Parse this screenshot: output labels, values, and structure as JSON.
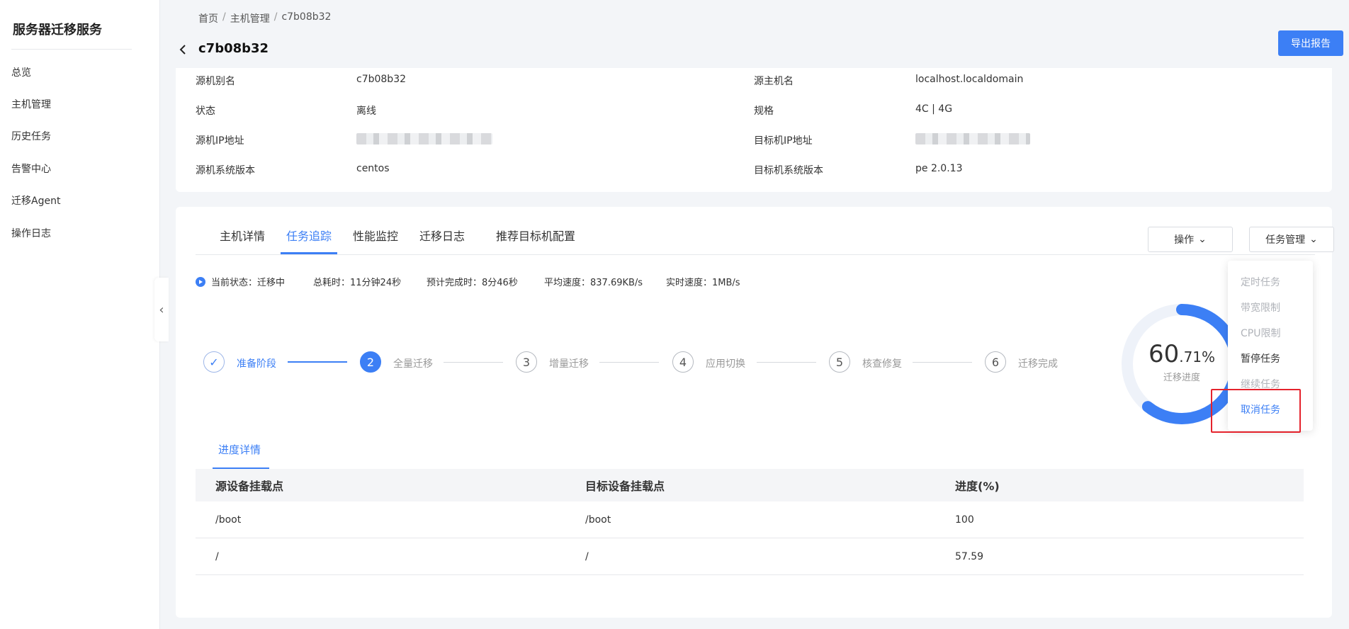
{
  "sidebar": {
    "title": "服务器迁移服务",
    "items": [
      {
        "label": "总览"
      },
      {
        "label": "主机管理"
      },
      {
        "label": "历史任务"
      },
      {
        "label": "告警中心"
      },
      {
        "label": "迁移Agent"
      },
      {
        "label": "操作日志"
      }
    ]
  },
  "breadcrumb": [
    "首页",
    "主机管理",
    "c7b08b32"
  ],
  "breadcrumb_sep": "/",
  "page_title": "c7b08b32",
  "export_label": "导出报告",
  "info": {
    "left": [
      {
        "label": "源机别名",
        "value": "c7b08b32"
      },
      {
        "label": "状态",
        "value": "离线"
      },
      {
        "label": "源机IP地址",
        "value": ""
      },
      {
        "label": "源机系统版本",
        "value": "centos"
      }
    ],
    "right": [
      {
        "label": "源主机名",
        "value": "localhost.localdomain"
      },
      {
        "label": "规格",
        "value": "4C | 4G"
      },
      {
        "label": "目标机IP地址",
        "value": ""
      },
      {
        "label": "目标机系统版本",
        "value": "pe 2.0.13"
      }
    ]
  },
  "tabs": [
    "主机详情",
    "任务追踪",
    "性能监控",
    "迁移日志",
    "推荐目标机配置"
  ],
  "active_tab": "任务追踪",
  "operate_label": "操作",
  "task_manage_label": "任务管理",
  "status": {
    "current": "当前状态：迁移中",
    "elapsed": "总耗时：11分钟24秒",
    "eta": "预计完成时：8分46秒",
    "avg_speed": "平均速度：837.69KB/s",
    "realtime_speed": "实时速度：1MB/s"
  },
  "steps": [
    {
      "num": "✓",
      "label": "准备阶段",
      "state": "done"
    },
    {
      "num": "2",
      "label": "全量迁移",
      "state": "current"
    },
    {
      "num": "3",
      "label": "增量迁移",
      "state": "pending"
    },
    {
      "num": "4",
      "label": "应用切换",
      "state": "pending"
    },
    {
      "num": "5",
      "label": "核查修复",
      "state": "pending"
    },
    {
      "num": "6",
      "label": "迁移完成",
      "state": "pending"
    }
  ],
  "progress": {
    "int": "60",
    "dec": ".71%",
    "value": 60.71,
    "label": "迁移进度"
  },
  "subtab": "进度详情",
  "table": {
    "headers": [
      "源设备挂载点",
      "目标设备挂载点",
      "进度(%)"
    ],
    "rows": [
      [
        "/boot",
        "/boot",
        "100"
      ],
      [
        "/",
        "/",
        "57.59"
      ]
    ]
  },
  "menu": [
    {
      "label": "定时任务",
      "enabled": false
    },
    {
      "label": "带宽限制",
      "enabled": false
    },
    {
      "label": "CPU限制",
      "enabled": false
    },
    {
      "label": "暂停任务",
      "enabled": true
    },
    {
      "label": "继续任务",
      "enabled": false
    },
    {
      "label": "取消任务",
      "enabled": true,
      "highlight": true
    }
  ],
  "colors": {
    "accent": "#3c7ff5",
    "highlight_box": "#e5232d"
  }
}
